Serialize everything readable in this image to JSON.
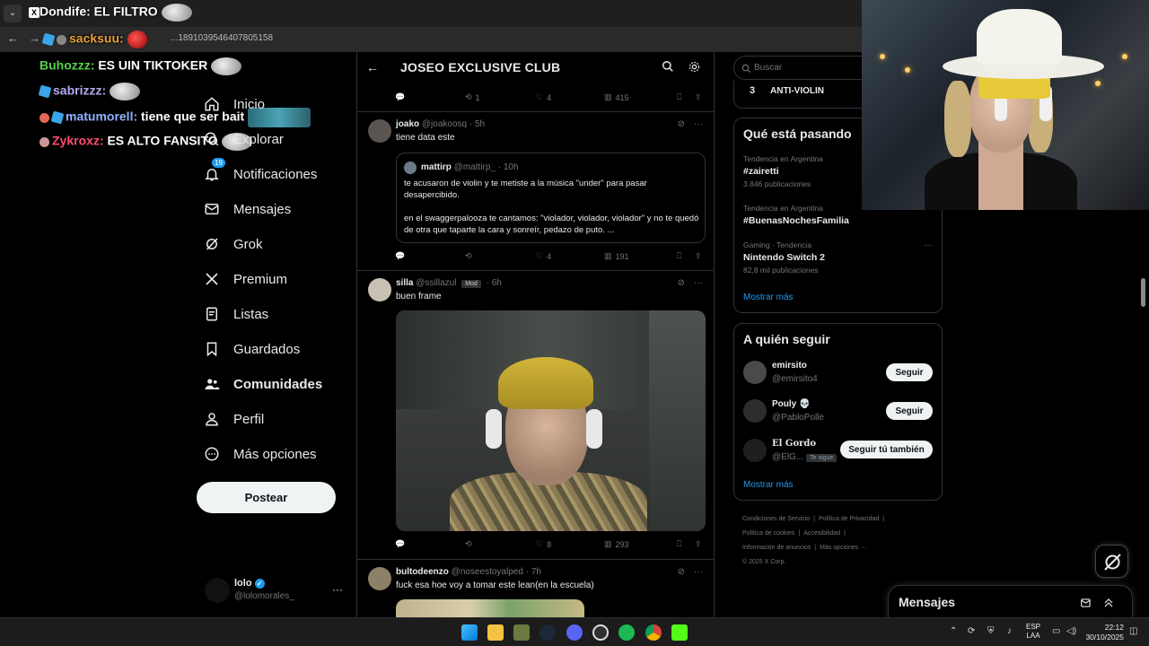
{
  "browser": {
    "tab_title": "Dondife: EL FILTRO",
    "tab_dropdown_glyph": "⌄",
    "x_glyph": "X",
    "url": "...1891039546407805158"
  },
  "chat_overlay": [
    {
      "user": "sacksuu:",
      "message": "",
      "user_color": "#e8a13a"
    },
    {
      "user": "Buhozzz:",
      "message": "ES UIN TIKTOKER",
      "user_color": "#58d04a"
    },
    {
      "user": "sabrizzz:",
      "message": "",
      "user_color": "#b7a8f0"
    },
    {
      "user": "matumorell:",
      "message": "tiene que ser bait",
      "user_color": "#8fb3ff"
    },
    {
      "user": "Zykroxz:",
      "message": "ES ALTO FANSITO",
      "user_color": "#ff4d6d"
    }
  ],
  "left_nav": {
    "items": [
      {
        "label": "Inicio",
        "icon": "home-icon"
      },
      {
        "label": "Explorar",
        "icon": "search-icon"
      },
      {
        "label": "Notificaciones",
        "icon": "bell-icon",
        "badge": "19"
      },
      {
        "label": "Mensajes",
        "icon": "mail-icon"
      },
      {
        "label": "Grok",
        "icon": "grok-icon"
      },
      {
        "label": "Premium",
        "icon": "x-logo-icon"
      },
      {
        "label": "Listas",
        "icon": "list-icon"
      },
      {
        "label": "Guardados",
        "icon": "bookmark-icon"
      },
      {
        "label": "Comunidades",
        "icon": "people-icon",
        "active": true
      },
      {
        "label": "Perfil",
        "icon": "person-icon"
      },
      {
        "label": "Más opciones",
        "icon": "more-circle-icon"
      }
    ],
    "post_button": "Postear",
    "account": {
      "name": "lolo",
      "handle": "@lolomorales_",
      "more": "···"
    }
  },
  "column": {
    "title": "JOSEO EXCLUSIVE CLUB",
    "back_glyph": "←"
  },
  "posts": [
    {
      "actions": {
        "replies": "",
        "reposts": "1",
        "likes": "4",
        "views": "415"
      }
    },
    {
      "name": "joako",
      "handle": "@joakoosq",
      "time": "· 5h",
      "text": "tiene data este",
      "quote": {
        "name": "mattirp",
        "handle": "@mattirp_",
        "time": "· 10h",
        "p1": "te acusaron de violin y te metiste a la música \"under\" para pasar desapercibido.",
        "p2": "en el swaggerpalooza te cantamos: \"violador, violador, violador\" y no te quedó de otra que taparte la cara y sonreír, pedazo de puto. ..."
      },
      "actions": {
        "replies": "",
        "reposts": "",
        "likes": "4",
        "views": "191"
      }
    },
    {
      "name": "silla",
      "handle": "@ssillazul",
      "badge": "Mod",
      "time": "· 6h",
      "text": "buen frame",
      "actions": {
        "replies": "",
        "reposts": "",
        "likes": "8",
        "views": "293"
      }
    },
    {
      "name": "bultodeenzo",
      "handle": "@noseestoyalped",
      "time": "· 7h",
      "text": "fuck esa hoe voy a tomar este lean(en la escuela)"
    }
  ],
  "right": {
    "search_placeholder": "Buscar",
    "top_item": {
      "rank": "3",
      "name": "ANTI-VIOLIN"
    },
    "trends_title": "Qué está pasando",
    "trends": [
      {
        "meta": "Tendencia en Argentina",
        "name": "#zairetti",
        "count": "3.846 publicaciones"
      },
      {
        "meta": "Tendencia en Argentina",
        "name": "#BuenasNochesFamilia",
        "count": ""
      },
      {
        "meta": "Gaming · Tendencia",
        "name": "Nintendo Switch 2",
        "count": "82,8 mil publicaciones"
      }
    ],
    "show_more": "Mostrar más",
    "follow_title": "A quién seguir",
    "follow": [
      {
        "name": "emirsito",
        "handle": "@emirsito4",
        "button": "Seguir"
      },
      {
        "name": "Pouly 💀",
        "handle": "@PabloPolle",
        "button": "Seguir"
      },
      {
        "name": "El Gordo",
        "handle": "@ElG...",
        "follows_you": "Te sigue",
        "button": "Seguir tú también"
      }
    ],
    "show_more_2": "Mostrar más",
    "footer": [
      "Condiciones de Servicio",
      "|",
      "Política de Privacidad",
      "|",
      "Política de cookies",
      "|",
      "Accesibilidad",
      "|",
      "Información de anuncios",
      "|",
      "Más opciones ···",
      "© 2025 X Corp."
    ]
  },
  "messages_drawer": {
    "title": "Mensajes"
  },
  "taskbar": {
    "lang_1": "ESP",
    "lang_2": "LAA",
    "time": "22:12",
    "date": "30/10/2025"
  },
  "colors": {
    "accent": "#1d9bf0",
    "background": "#000000",
    "text": "#e7e9ea",
    "muted": "#71767b",
    "border": "#2f3336"
  }
}
